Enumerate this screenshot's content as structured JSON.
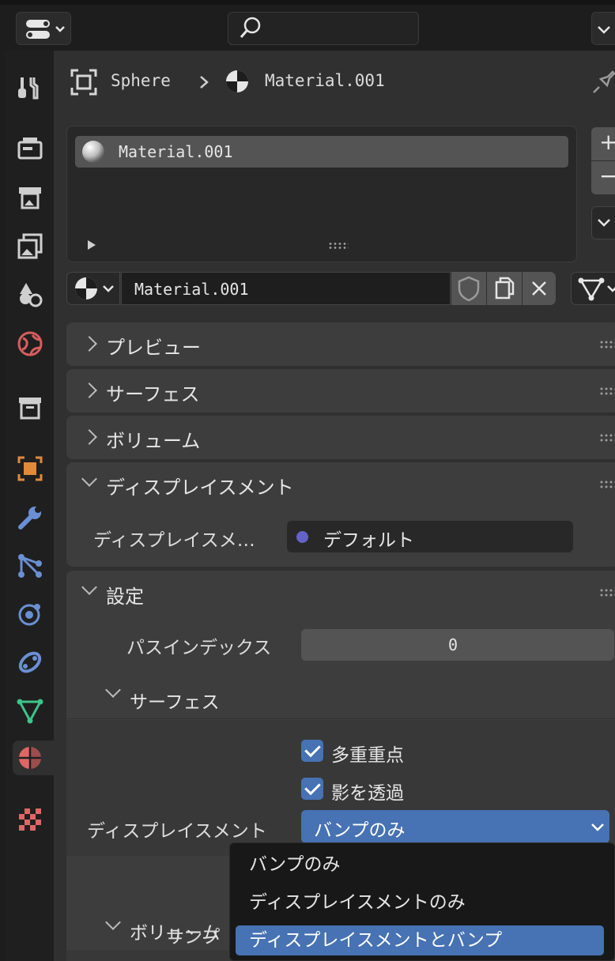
{
  "header": {
    "search_placeholder": ""
  },
  "breadcrumb": {
    "object": "Sphere",
    "material": "Material.001"
  },
  "material_slots": {
    "items": [
      "Material.001"
    ],
    "add": "+",
    "remove": "−"
  },
  "material_selector": {
    "name": "Material.001"
  },
  "panels": {
    "preview": "プレビュー",
    "surface": "サーフェス",
    "volume": "ボリューム",
    "displacement": "ディスプレイスメント",
    "settings": "設定"
  },
  "displacement_panel": {
    "label": "ディスプレイスメ…",
    "value": "デフォルト"
  },
  "settings_panel": {
    "pass_index_label": "パスインデックス",
    "pass_index_value": "0",
    "surface_sub": "サーフェス",
    "multi_sampling": "多重重点",
    "shadow_transparency": "影を透過",
    "displacement_label": "ディスプレイスメント",
    "displacement_value": "バンプのみ",
    "volume_sub": "ボリューム",
    "sampling_label_partial": "サンプ"
  },
  "dropdown": {
    "options": [
      "バンプのみ",
      "ディスプレイスメントのみ",
      "ディスプレイスメントとバンプ"
    ],
    "highlighted_index": 2
  },
  "colors": {
    "accent": "#4772b3",
    "socket_purple": "#6363c7",
    "material_red": "#e06666"
  }
}
